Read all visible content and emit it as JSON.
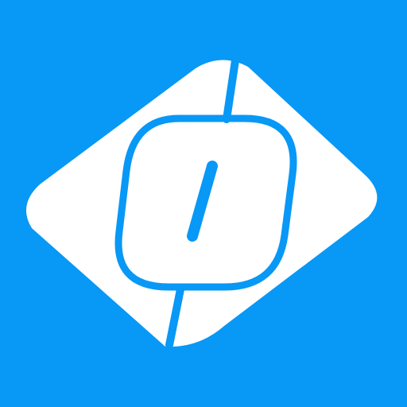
{
  "app_icon": {
    "icon_name": "ticket-zero-icon",
    "colors": {
      "background": "#0898F6",
      "ticket": "#FFFFFF",
      "accent": "#0898F6"
    }
  }
}
